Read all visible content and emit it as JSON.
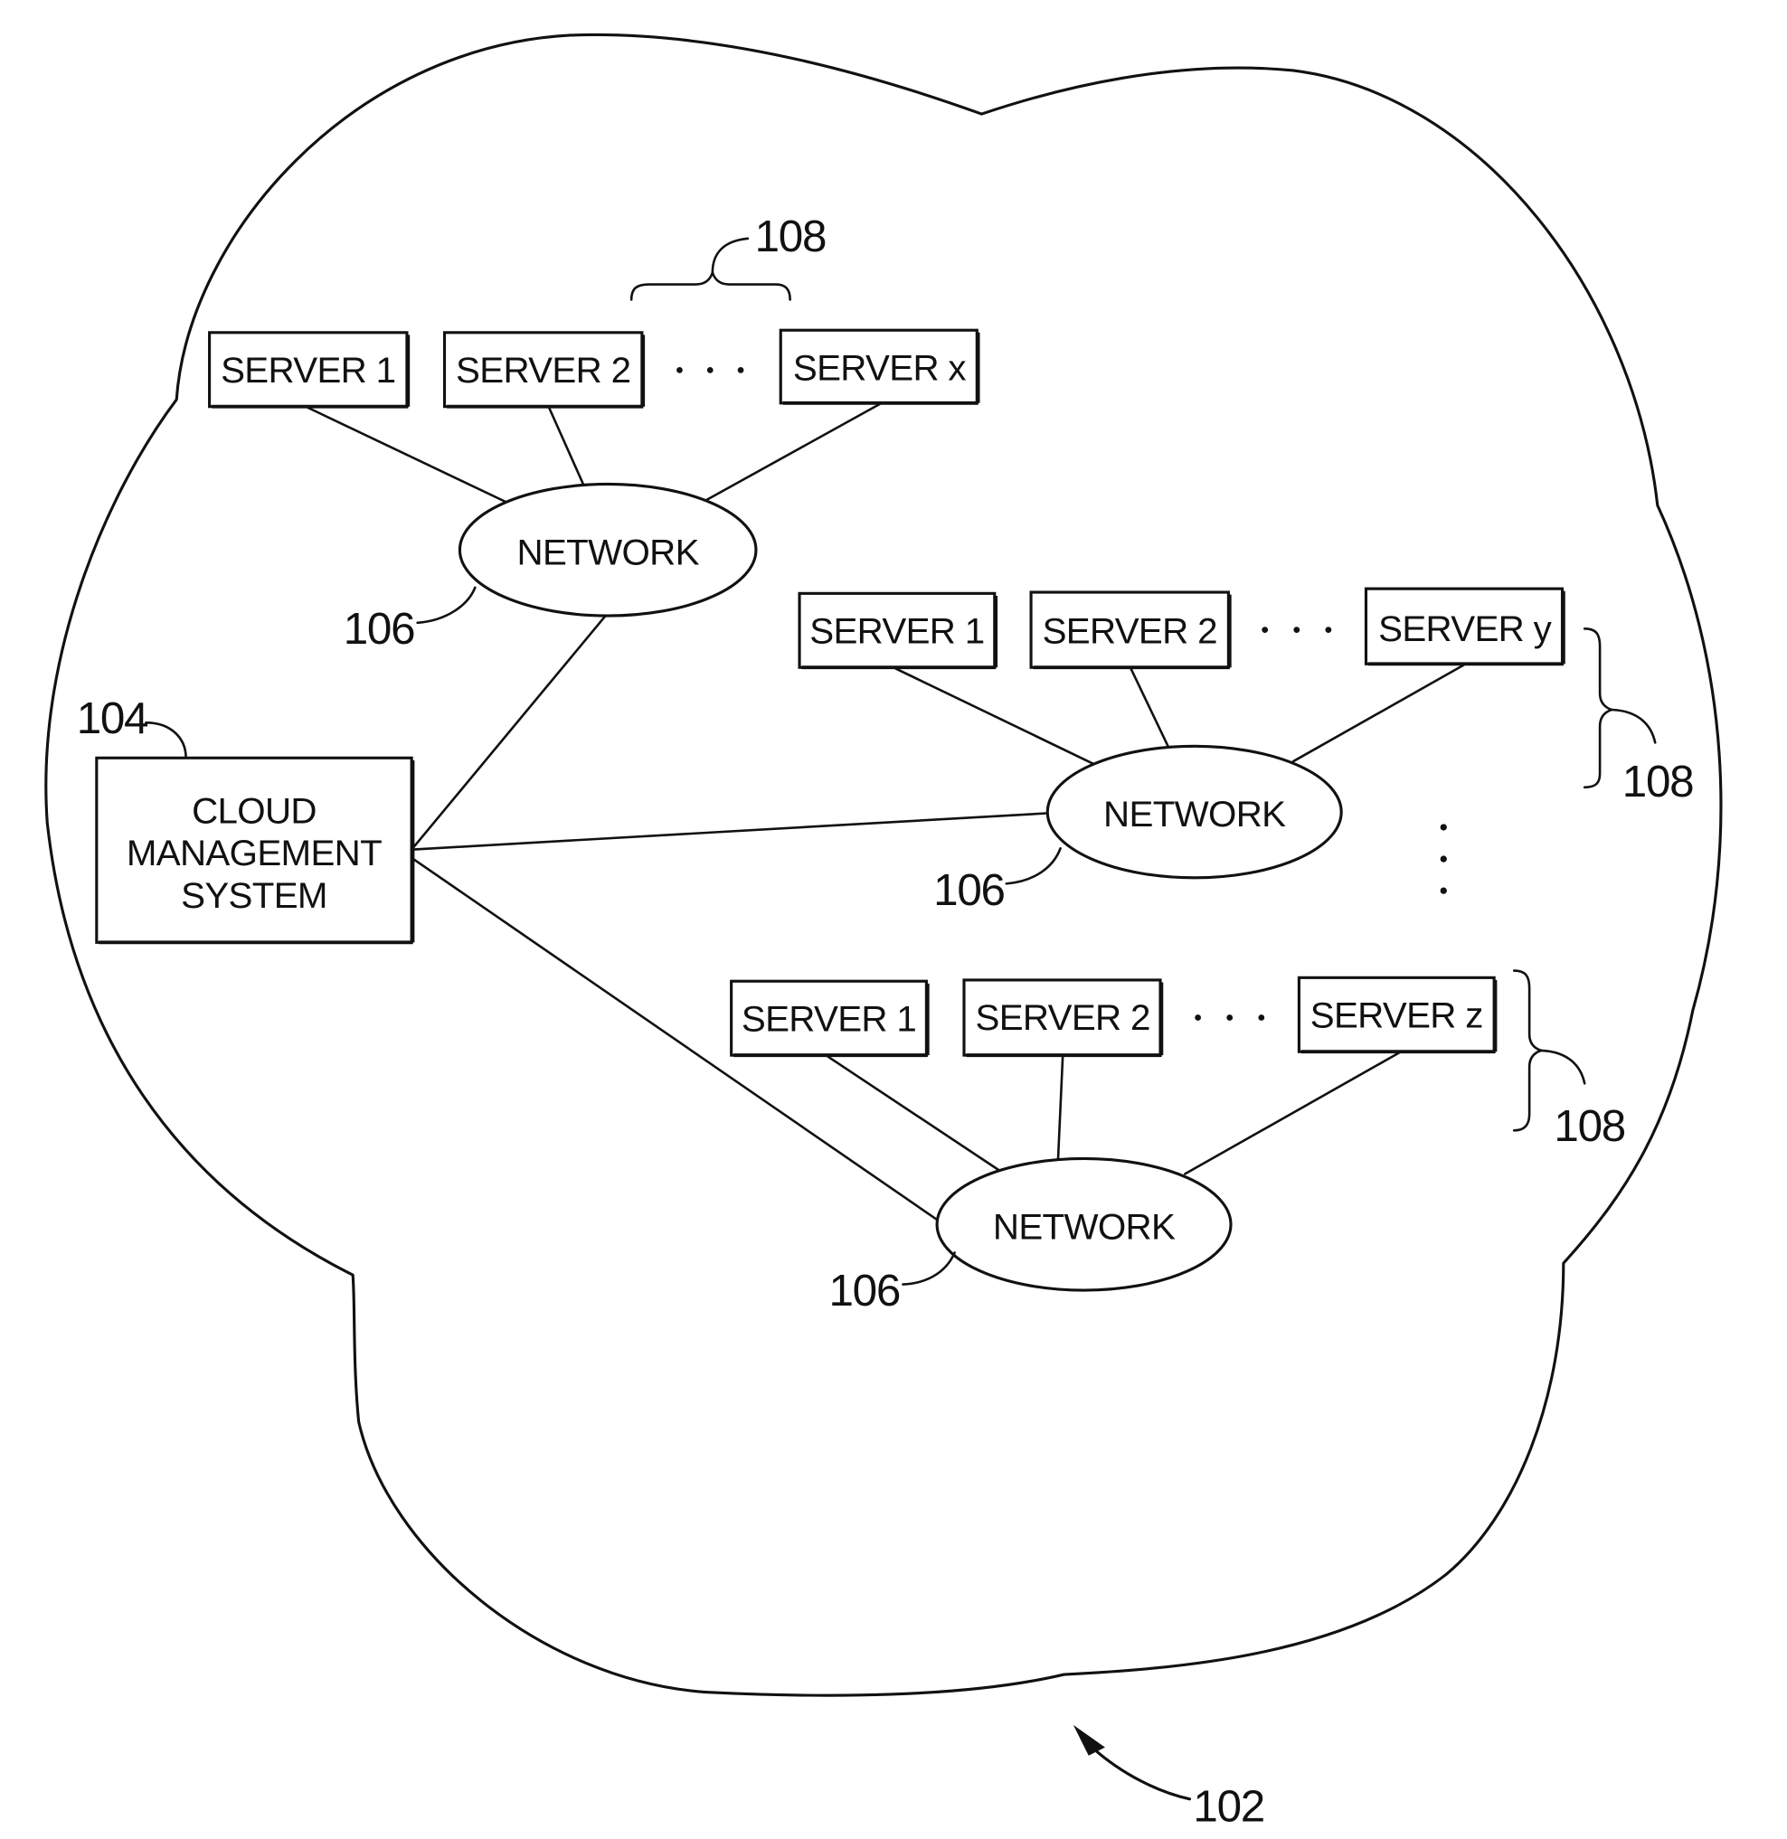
{
  "figure": {
    "cloud_ref": "102",
    "cloud_management_system": {
      "ref": "104",
      "lines": [
        "CLOUD",
        "MANAGEMENT",
        "SYSTEM"
      ]
    },
    "clusters": [
      {
        "network_label": "NETWORK",
        "network_ref": "106",
        "group_ref": "108",
        "servers": [
          "SERVER 1",
          "SERVER 2",
          "SERVER x"
        ],
        "ellipsis": "· · ·"
      },
      {
        "network_label": "NETWORK",
        "network_ref": "106",
        "group_ref": "108",
        "servers": [
          "SERVER 1",
          "SERVER 2",
          "SERVER y"
        ],
        "ellipsis": "· · ·"
      },
      {
        "network_label": "NETWORK",
        "network_ref": "106",
        "group_ref": "108",
        "servers": [
          "SERVER 1",
          "SERVER 2",
          "SERVER z"
        ],
        "ellipsis": "· · ·"
      }
    ]
  }
}
